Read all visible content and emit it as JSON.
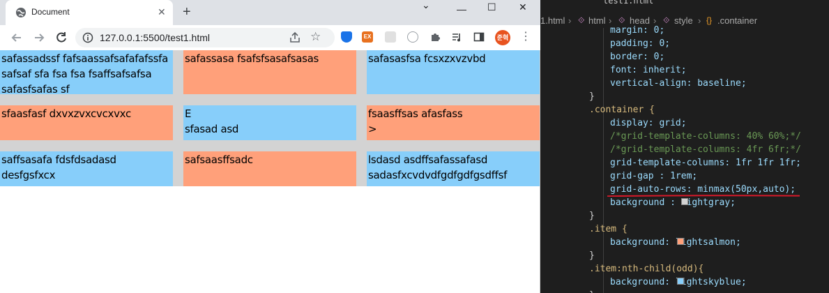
{
  "browser": {
    "tab_title": "Document",
    "url": "127.0.0.1:5500/test1.html",
    "avatar_text": "준혁",
    "ext_badge": "EX"
  },
  "grid_cells": [
    "safassadssf fafsaassafsafafafssfa safsaf sfa fsa fsa fsaffsafsafsa safasfsafas sf",
    "safassasa fsafsfsasafsasas",
    "safasasfsa fcsxzxvzvbd",
    "sfaasfasf dxvxzvxcvcxvxc",
    "E\nsfasad asd",
    "fsaasffsas afasfass\n>",
    "saffsasafa fdsfdsadasd desfgsfxcx",
    "safsaasffsadc",
    "lsdasd asdffsafassafasd sadasfxcvdvdfgdfgdfgsdffsf"
  ],
  "editor": {
    "tab": "test1.html",
    "breadcrumbs": [
      "1.html",
      "html",
      "head",
      "style",
      ".container"
    ],
    "lines": [
      "margin: 0;",
      "padding: 0;",
      "border: 0;",
      "font: inherit;",
      "vertical-align: baseline;",
      "}",
      ".container {",
      "display: grid;",
      "/*grid-template-columns: 40% 60%;*/",
      "/*grid-template-columns: 4fr 6fr;*/",
      "grid-template-columns: 1fr 1fr 1fr;",
      "grid-gap : 1rem;",
      "grid-auto-rows: minmax(50px,auto);",
      "background : lightgray;",
      "}",
      ".item {",
      "background: lightsalmon;",
      "}",
      ".item:nth-child(odd){",
      "background: lightskyblue;",
      "}"
    ]
  },
  "colors": {
    "odd": "#87cefa",
    "even": "#ffa07a",
    "grid_bg": "#d3d3d3",
    "underline": "#d7192a"
  }
}
